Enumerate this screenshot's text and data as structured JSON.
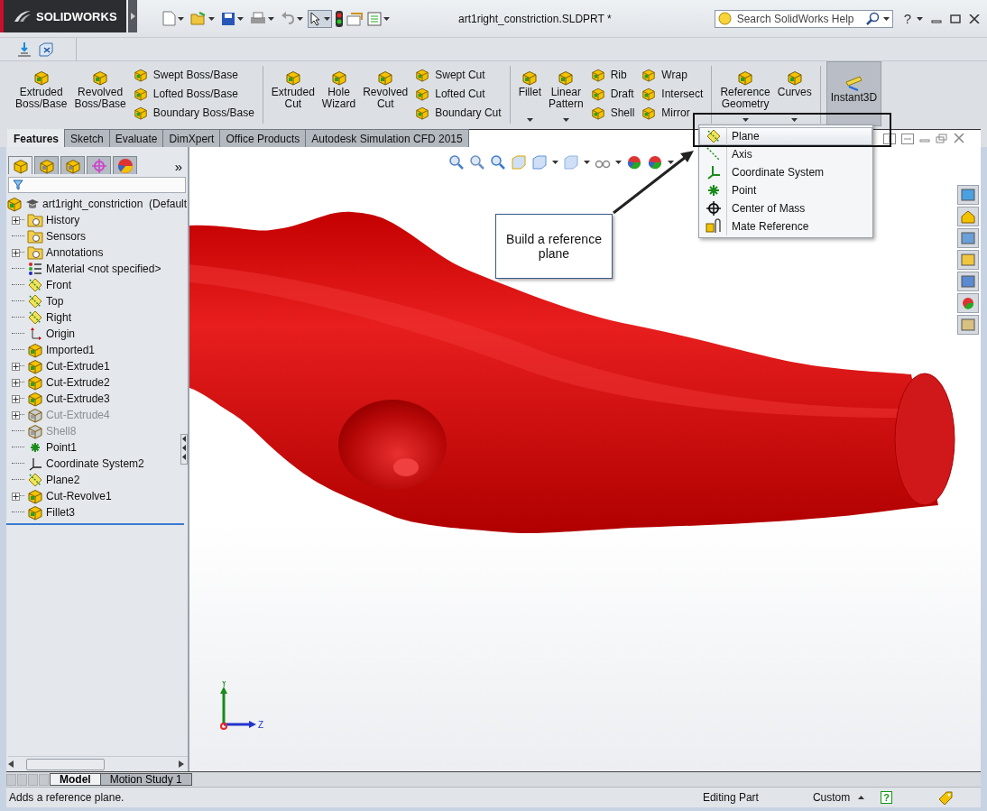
{
  "title_bar": {
    "logo": "SOLIDWORKS",
    "title": "art1right_constriction.SLDPRT *",
    "search": {
      "placeholder": "Search SolidWorks Help"
    },
    "help": "?"
  },
  "ribbon": {
    "groups": [
      {
        "items": [
          {
            "kind": "large",
            "label": "Extruded\nBoss/Base",
            "caret": false,
            "selected": false
          },
          {
            "kind": "large",
            "label": "Revolved\nBoss/Base",
            "caret": false,
            "selected": false
          },
          {
            "kind": "column",
            "items": [
              "Swept Boss/Base",
              "Lofted Boss/Base",
              "Boundary Boss/Base"
            ]
          }
        ]
      },
      {
        "items": [
          {
            "kind": "large",
            "label": "Extruded\nCut",
            "caret": false,
            "selected": false
          },
          {
            "kind": "large",
            "label": "Hole\nWizard",
            "caret": false,
            "selected": false
          },
          {
            "kind": "large",
            "label": "Revolved\nCut",
            "caret": false,
            "selected": false
          },
          {
            "kind": "column",
            "items": [
              "Swept Cut",
              "Lofted Cut",
              "Boundary Cut"
            ]
          }
        ]
      },
      {
        "items": [
          {
            "kind": "large",
            "label": "Fillet",
            "caret": true,
            "selected": false
          },
          {
            "kind": "large",
            "label": "Linear\nPattern",
            "caret": true,
            "selected": false
          },
          {
            "kind": "column",
            "items": [
              "Rib",
              "Draft",
              "Shell"
            ]
          },
          {
            "kind": "column",
            "items": [
              "Wrap",
              "Intersect",
              "Mirror"
            ]
          }
        ]
      },
      {
        "items": [
          {
            "kind": "large",
            "label": "Reference\nGeometry",
            "caret": true,
            "selected": false
          },
          {
            "kind": "large",
            "label": "Curves",
            "caret": true,
            "selected": false
          }
        ]
      },
      {
        "items": [
          {
            "kind": "large",
            "label": "Instant3D",
            "caret": false,
            "selected": true
          }
        ]
      }
    ]
  },
  "command_tabs": [
    {
      "label": "Features",
      "selected": true
    },
    {
      "label": "Sketch",
      "selected": false
    },
    {
      "label": "Evaluate",
      "selected": false
    },
    {
      "label": "DimXpert",
      "selected": false
    },
    {
      "label": "Office Products",
      "selected": false
    },
    {
      "label": "Autodesk Simulation CFD 2015",
      "selected": false
    }
  ],
  "feature_tree": {
    "panel_tabs": [
      {
        "selected": true
      },
      {
        "selected": false
      },
      {
        "selected": false
      },
      {
        "selected": false
      },
      {
        "selected": false
      }
    ],
    "more": "»",
    "root": {
      "label": "art1right_constriction  (Default",
      "kind": "part",
      "children": [
        {
          "label": "History",
          "kind": "folder",
          "collapsed": true,
          "suppressed": false
        },
        {
          "label": "Sensors",
          "kind": "folder",
          "collapsed": false,
          "suppressed": false
        },
        {
          "label": "Annotations",
          "kind": "folder",
          "collapsed": true,
          "suppressed": false
        },
        {
          "label": "Material <not specified>",
          "kind": "material",
          "collapsed": false,
          "suppressed": false
        },
        {
          "label": "Front",
          "kind": "plane",
          "collapsed": false,
          "suppressed": false
        },
        {
          "label": "Top",
          "kind": "plane",
          "collapsed": false,
          "suppressed": false
        },
        {
          "label": "Right",
          "kind": "plane",
          "collapsed": false,
          "suppressed": false
        },
        {
          "label": "Origin",
          "kind": "origin",
          "collapsed": false,
          "suppressed": false
        },
        {
          "label": "Imported1",
          "kind": "feature",
          "collapsed": false,
          "suppressed": false
        },
        {
          "label": "Cut-Extrude1",
          "kind": "feature",
          "collapsed": true,
          "suppressed": false
        },
        {
          "label": "Cut-Extrude2",
          "kind": "feature",
          "collapsed": true,
          "suppressed": false
        },
        {
          "label": "Cut-Extrude3",
          "kind": "feature",
          "collapsed": true,
          "suppressed": false
        },
        {
          "label": "Cut-Extrude4",
          "kind": "feature",
          "collapsed": true,
          "suppressed": true
        },
        {
          "label": "Shell8",
          "kind": "feature",
          "collapsed": false,
          "suppressed": true
        },
        {
          "label": "Point1",
          "kind": "point",
          "collapsed": false,
          "suppressed": false
        },
        {
          "label": "Coordinate System2",
          "kind": "axes",
          "collapsed": false,
          "suppressed": false
        },
        {
          "label": "Plane2",
          "kind": "plane",
          "collapsed": false,
          "suppressed": false
        },
        {
          "label": "Cut-Revolve1",
          "kind": "feature",
          "collapsed": true,
          "suppressed": false
        },
        {
          "label": "Fillet3",
          "kind": "feature",
          "collapsed": false,
          "suppressed": false
        }
      ]
    }
  },
  "viewport": {
    "callout": "Build a reference plane",
    "triad": {
      "y": "Y",
      "z": "Z"
    }
  },
  "reference_geometry_menu": [
    {
      "label": "Plane",
      "selected": true
    },
    {
      "label": "Axis",
      "selected": false
    },
    {
      "label": "Coordinate System",
      "selected": false
    },
    {
      "label": "Point",
      "selected": false
    },
    {
      "label": "Center of Mass",
      "selected": false
    },
    {
      "label": "Mate Reference",
      "selected": false
    }
  ],
  "bottom_tabs": [
    {
      "label": "Model",
      "selected": true
    },
    {
      "label": "Motion Study 1",
      "selected": false
    }
  ],
  "status_bar": {
    "message": "Adds a reference plane.",
    "mode": "Editing Part",
    "units": "Custom",
    "help": "?"
  }
}
